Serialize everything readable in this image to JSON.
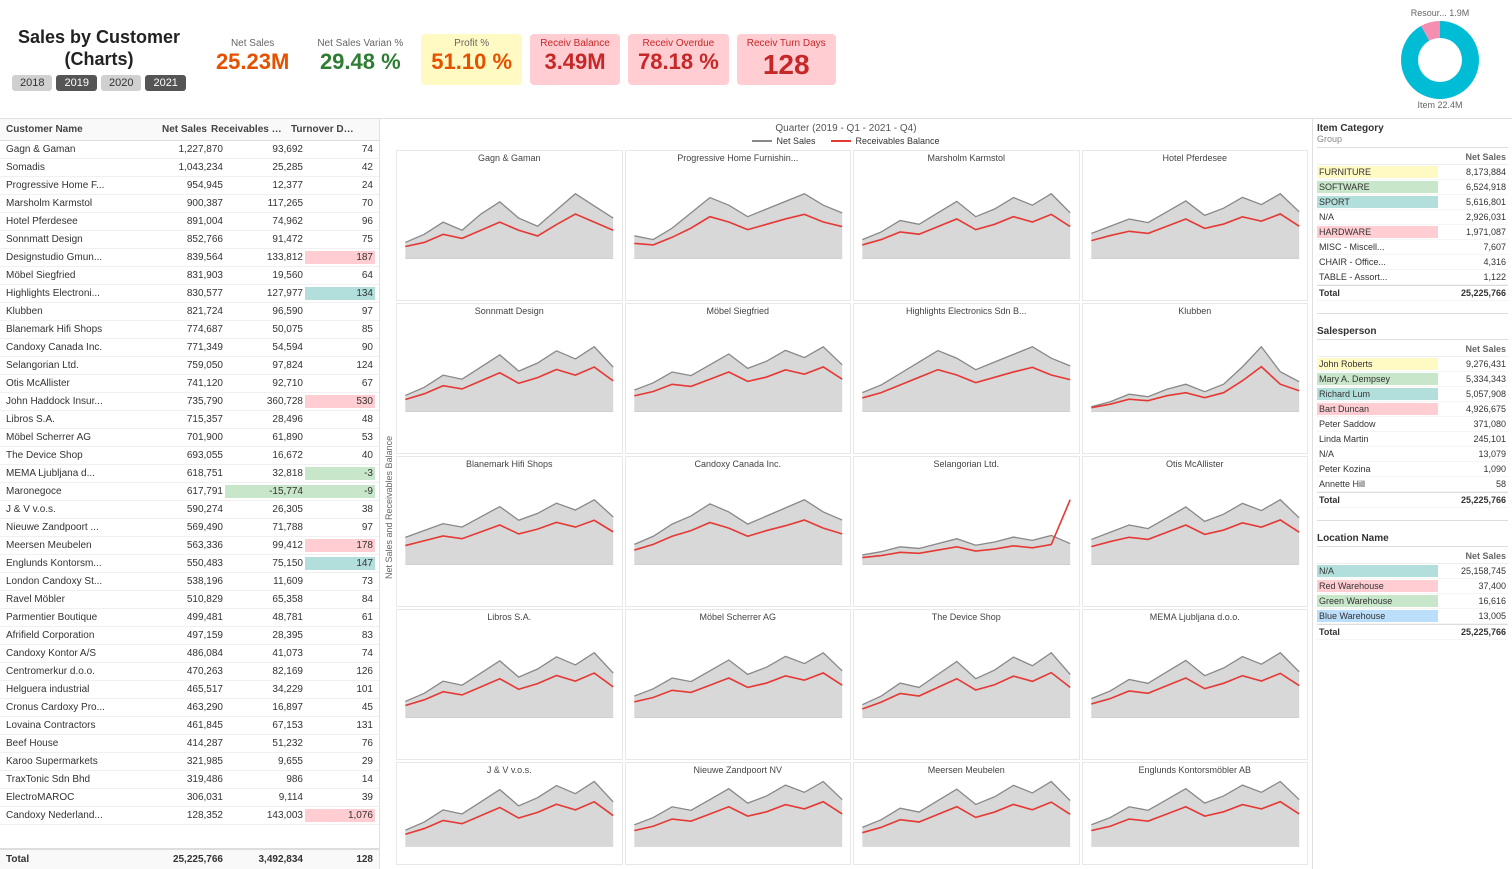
{
  "header": {
    "title": "Sales by Customer\n(Charts)",
    "title_line1": "Sales by Customer",
    "title_line2": "(Charts)",
    "years": [
      "2018",
      "2019",
      "2020",
      "2021"
    ],
    "kpis": [
      {
        "label": "Net Sales",
        "value": "25.23M",
        "color": "orange",
        "bg": ""
      },
      {
        "label": "Net Sales Varian %",
        "value": "29.48 %",
        "color": "green",
        "bg": ""
      },
      {
        "label": "Profit %",
        "value": "51.10 %",
        "color": "orange",
        "bg": "yellow"
      },
      {
        "label": "Receiv Balance",
        "value": "3.49M",
        "color": "red",
        "bg": "red"
      },
      {
        "label": "Receiv Overdue",
        "value": "78.18 %",
        "color": "red",
        "bg": "red"
      },
      {
        "label": "Receiv Turn Days",
        "value": "128",
        "color": "red",
        "bg": "red"
      }
    ],
    "donut": {
      "label1": "Resour... 1.9M",
      "label2": "Item 22.4M"
    }
  },
  "left_table": {
    "headers": [
      "Customer Name",
      "Net Sales",
      "Receivables Balance",
      "Turnover Days"
    ],
    "rows": [
      {
        "name": "Gagn & Gaman",
        "net_sales": "1,227,870",
        "rec_balance": "93,692",
        "days": "74",
        "days_color": ""
      },
      {
        "name": "Somadis",
        "net_sales": "1,043,234",
        "rec_balance": "25,285",
        "days": "42",
        "days_color": ""
      },
      {
        "name": "Progressive Home F...",
        "net_sales": "954,945",
        "rec_balance": "12,377",
        "days": "24",
        "days_color": ""
      },
      {
        "name": "Marsholm Karmstol",
        "net_sales": "900,387",
        "rec_balance": "117,265",
        "days": "70",
        "days_color": ""
      },
      {
        "name": "Hotel Pferdesee",
        "net_sales": "891,004",
        "rec_balance": "74,962",
        "days": "96",
        "days_color": ""
      },
      {
        "name": "Sonnmatt Design",
        "net_sales": "852,766",
        "rec_balance": "91,472",
        "days": "75",
        "days_color": ""
      },
      {
        "name": "Designstudio Gmun...",
        "net_sales": "839,564",
        "rec_balance": "133,812",
        "days": "187",
        "days_color": "red"
      },
      {
        "name": "Möbel Siegfried",
        "net_sales": "831,903",
        "rec_balance": "19,560",
        "days": "64",
        "days_color": ""
      },
      {
        "name": "Highlights Electroni...",
        "net_sales": "830,577",
        "rec_balance": "127,977",
        "days": "134",
        "days_color": "teal"
      },
      {
        "name": "Klubben",
        "net_sales": "821,724",
        "rec_balance": "96,590",
        "days": "97",
        "days_color": ""
      },
      {
        "name": "Blanemark Hifi Shops",
        "net_sales": "774,687",
        "rec_balance": "50,075",
        "days": "85",
        "days_color": ""
      },
      {
        "name": "Candoxy Canada Inc.",
        "net_sales": "771,349",
        "rec_balance": "54,594",
        "days": "90",
        "days_color": ""
      },
      {
        "name": "Selangorian Ltd.",
        "net_sales": "759,050",
        "rec_balance": "97,824",
        "days": "124",
        "days_color": ""
      },
      {
        "name": "Otis McAllister",
        "net_sales": "741,120",
        "rec_balance": "92,710",
        "days": "67",
        "days_color": ""
      },
      {
        "name": "John Haddock Insur...",
        "net_sales": "735,790",
        "rec_balance": "360,728",
        "days": "530",
        "days_color": "red"
      },
      {
        "name": "Libros S.A.",
        "net_sales": "715,357",
        "rec_balance": "28,496",
        "days": "48",
        "days_color": ""
      },
      {
        "name": "Möbel Scherrer AG",
        "net_sales": "701,900",
        "rec_balance": "61,890",
        "days": "53",
        "days_color": ""
      },
      {
        "name": "The Device Shop",
        "net_sales": "693,055",
        "rec_balance": "16,672",
        "days": "40",
        "days_color": ""
      },
      {
        "name": "MEMA Ljubljana d...",
        "net_sales": "618,751",
        "rec_balance": "32,818",
        "days": "-3",
        "days_color": "green"
      },
      {
        "name": "Maronegoce",
        "net_sales": "617,791",
        "rec_balance": "-15,774",
        "days": "-9",
        "days_color": "green"
      },
      {
        "name": "J & V v.o.s.",
        "net_sales": "590,274",
        "rec_balance": "26,305",
        "days": "38",
        "days_color": ""
      },
      {
        "name": "Nieuwe Zandpoort ...",
        "net_sales": "569,490",
        "rec_balance": "71,788",
        "days": "97",
        "days_color": ""
      },
      {
        "name": "Meersen Meubelen",
        "net_sales": "563,336",
        "rec_balance": "99,412",
        "days": "178",
        "days_color": "red"
      },
      {
        "name": "Englunds Kontorsm...",
        "net_sales": "550,483",
        "rec_balance": "75,150",
        "days": "147",
        "days_color": "teal"
      },
      {
        "name": "London Candoxy St...",
        "net_sales": "538,196",
        "rec_balance": "11,609",
        "days": "73",
        "days_color": ""
      },
      {
        "name": "Ravel Möbler",
        "net_sales": "510,829",
        "rec_balance": "65,358",
        "days": "84",
        "days_color": ""
      },
      {
        "name": "Parmentier Boutique",
        "net_sales": "499,481",
        "rec_balance": "48,781",
        "days": "61",
        "days_color": ""
      },
      {
        "name": "Afrifield Corporation",
        "net_sales": "497,159",
        "rec_balance": "28,395",
        "days": "83",
        "days_color": ""
      },
      {
        "name": "Candoxy Kontor A/S",
        "net_sales": "486,084",
        "rec_balance": "41,073",
        "days": "74",
        "days_color": ""
      },
      {
        "name": "Centromerkur d.o.o.",
        "net_sales": "470,263",
        "rec_balance": "82,169",
        "days": "126",
        "days_color": ""
      },
      {
        "name": "Helguera industrial",
        "net_sales": "465,517",
        "rec_balance": "34,229",
        "days": "101",
        "days_color": ""
      },
      {
        "name": "Cronus Cardoxy Pro...",
        "net_sales": "463,290",
        "rec_balance": "16,897",
        "days": "45",
        "days_color": ""
      },
      {
        "name": "Lovaina Contractors",
        "net_sales": "461,845",
        "rec_balance": "67,153",
        "days": "131",
        "days_color": ""
      },
      {
        "name": "Beef House",
        "net_sales": "414,287",
        "rec_balance": "51,232",
        "days": "76",
        "days_color": ""
      },
      {
        "name": "Karoo Supermarkets",
        "net_sales": "321,985",
        "rec_balance": "9,655",
        "days": "29",
        "days_color": ""
      },
      {
        "name": "TraxTonic Sdn Bhd",
        "net_sales": "319,486",
        "rec_balance": "986",
        "days": "14",
        "days_color": ""
      },
      {
        "name": "ElectroMAROC",
        "net_sales": "306,031",
        "rec_balance": "9,114",
        "days": "39",
        "days_color": ""
      },
      {
        "name": "Candoxy Nederland...",
        "net_sales": "128,352",
        "rec_balance": "143,003",
        "days": "1,076",
        "days_color": "red"
      }
    ],
    "total": {
      "name": "Total",
      "net_sales": "25,225,766",
      "rec_balance": "3,492,834",
      "days": "128"
    }
  },
  "chart": {
    "title": "Quarter (2019 - Q1 - 2021 - Q4)",
    "legend": [
      "Net Sales",
      "Receivables Balance"
    ],
    "y_label": "Net Sales and Receivables Balance",
    "charts": [
      {
        "name": "Gagn & Gaman"
      },
      {
        "name": "Progressive Home Furnishin..."
      },
      {
        "name": "Marsholm Karmstol"
      },
      {
        "name": "Hotel Pferdesee"
      },
      {
        "name": "Sonnmatt Design"
      },
      {
        "name": "Möbel Siegfried"
      },
      {
        "name": "Highlights Electronics Sdn B..."
      },
      {
        "name": "Klubben"
      },
      {
        "name": "Blanemark Hifi Shops"
      },
      {
        "name": "Candoxy Canada Inc."
      },
      {
        "name": "Selangorian Ltd."
      },
      {
        "name": "Otis McAllister"
      },
      {
        "name": "Libros S.A."
      },
      {
        "name": "Möbel Scherrer AG"
      },
      {
        "name": "The Device Shop"
      },
      {
        "name": "MEMA Ljubljana d.o.o."
      },
      {
        "name": "J & V v.o.s."
      },
      {
        "name": "Nieuwe Zandpoort NV"
      },
      {
        "name": "Meersen Meubelen"
      },
      {
        "name": "Englunds Kontorsmöbler AB"
      }
    ]
  },
  "right": {
    "item_category": {
      "title": "Item Category",
      "sub_title": "Group",
      "header_label": "Net Sales",
      "rows": [
        {
          "name": "FURNITURE",
          "value": "8,173,884",
          "color": "yellow"
        },
        {
          "name": "SOFTWARE",
          "value": "6,524,918",
          "color": "green"
        },
        {
          "name": "SPORT",
          "value": "5,616,801",
          "color": "teal"
        },
        {
          "name": "N/A",
          "value": "2,926,031",
          "color": ""
        },
        {
          "name": "HARDWARE",
          "value": "1,971,087",
          "color": "red"
        },
        {
          "name": "MISC - Miscell...",
          "value": "7,607",
          "color": ""
        },
        {
          "name": "CHAIR - Office...",
          "value": "4,316",
          "color": ""
        },
        {
          "name": "TABLE - Assort...",
          "value": "1,122",
          "color": ""
        },
        {
          "name": "Total",
          "value": "25,225,766",
          "color": "total"
        }
      ]
    },
    "salesperson": {
      "title": "Salesperson",
      "header_label": "Net Sales",
      "rows": [
        {
          "name": "John Roberts",
          "value": "9,276,431",
          "color": "yellow"
        },
        {
          "name": "Mary A. Dempsey",
          "value": "5,334,343",
          "color": "green"
        },
        {
          "name": "Richard Lum",
          "value": "5,057,908",
          "color": "teal"
        },
        {
          "name": "Bart Duncan",
          "value": "4,926,675",
          "color": "red"
        },
        {
          "name": "Peter Saddow",
          "value": "371,080",
          "color": ""
        },
        {
          "name": "Linda Martin",
          "value": "245,101",
          "color": ""
        },
        {
          "name": "N/A",
          "value": "13,079",
          "color": ""
        },
        {
          "name": "Peter Kozina",
          "value": "1,090",
          "color": ""
        },
        {
          "name": "Annette Hill",
          "value": "58",
          "color": ""
        },
        {
          "name": "Total",
          "value": "25,225,766",
          "color": "total"
        }
      ]
    },
    "location": {
      "title": "Location Name",
      "header_label": "Net Sales",
      "rows": [
        {
          "name": "N/A",
          "value": "25,158,745",
          "color": "teal"
        },
        {
          "name": "Red Warehouse",
          "value": "37,400",
          "color": "red"
        },
        {
          "name": "Green Warehouse",
          "value": "16,616",
          "color": "green"
        },
        {
          "name": "Blue Warehouse",
          "value": "13,005",
          "color": "blue"
        },
        {
          "name": "Total",
          "value": "25,225,766",
          "color": "total"
        }
      ]
    }
  }
}
